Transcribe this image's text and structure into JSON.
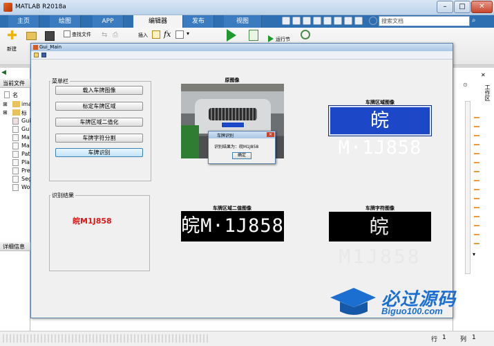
{
  "app": {
    "title": "MATLAB R2018a"
  },
  "tabs": [
    {
      "label": "主页"
    },
    {
      "label": "绘图"
    },
    {
      "label": "APP"
    },
    {
      "label": "编辑器"
    },
    {
      "label": "发布"
    },
    {
      "label": "视图"
    }
  ],
  "search": {
    "placeholder": "搜索文档"
  },
  "ribbon": {
    "new_label": "新建",
    "find_files_label": "查找文件",
    "insert_label": "插入",
    "fx_label": "fx",
    "run_section_label": "运行节"
  },
  "left_pane": {
    "current_folder_label": "当前文件",
    "name_col": "名",
    "details_label": "详细信息",
    "files": [
      "ima",
      "标",
      "Gui",
      "Gu",
      "Ma",
      "Ma",
      "Pat",
      "Pla",
      "Pre",
      "Seg",
      "Wo"
    ]
  },
  "right_pane": {
    "workspace_label": "工作区"
  },
  "status": {
    "row_label": "行",
    "row_value": "1",
    "col_label": "列",
    "col_value": "1"
  },
  "gui": {
    "title": "Gui_Main",
    "menu_group_label": "菜单栏",
    "buttons": [
      {
        "label": "载入车牌图像"
      },
      {
        "label": "标定车牌区域"
      },
      {
        "label": "车牌区域二值化"
      },
      {
        "label": "车牌字符分割"
      },
      {
        "label": "车牌识别"
      }
    ],
    "result_group_label": "识别结果",
    "result_text": "皖M1J858",
    "captions": {
      "original": "原图像",
      "plate_region": "车牌区域图像",
      "plate_binary": "车牌区域二值图像",
      "plate_chars": "车牌字符图像"
    },
    "plate_text": "皖M·1J858",
    "plate_chars_text": "皖M1J858"
  },
  "dialog": {
    "title": "车牌识别",
    "message": "识别结果为：皖M1J858",
    "ok_label": "确定"
  },
  "watermark": {
    "main": "必过源码",
    "sub": "Biguo100.com"
  },
  "colors": {
    "result_red": "#e01818",
    "tab_blue": "#2d6fb0",
    "plate_blue": "#1c47c6"
  }
}
